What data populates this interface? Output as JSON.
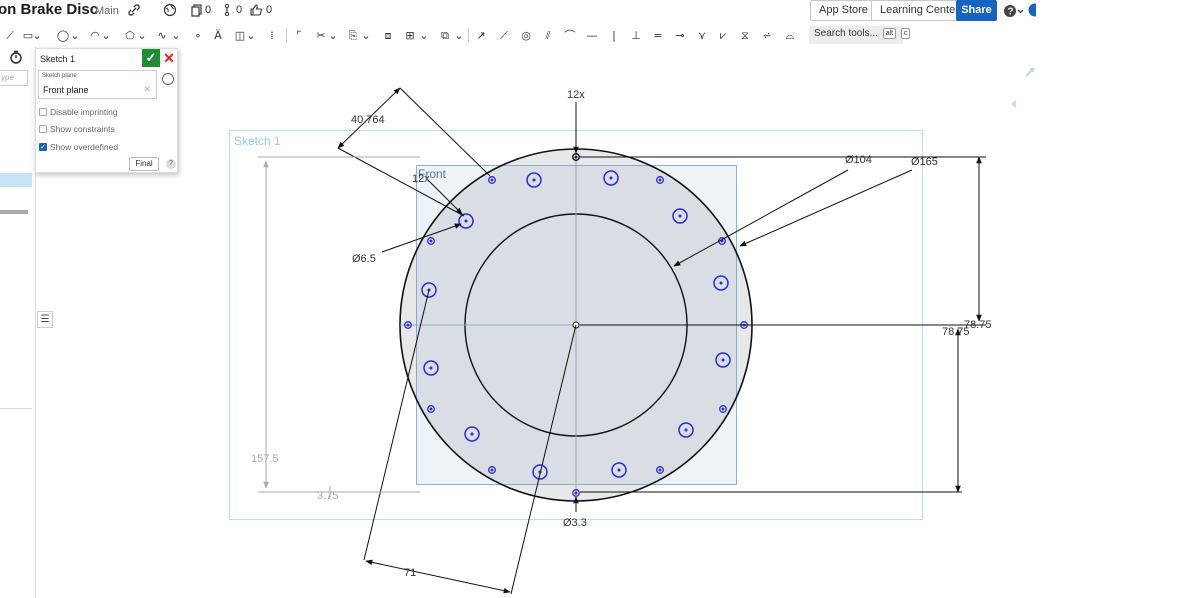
{
  "header": {
    "doc_title": "on Brake Disc",
    "branch": "Main",
    "count_a": "0",
    "count_b": "0",
    "count_c": "0",
    "app_store": "App Store",
    "learning_center": "Learning Center",
    "share": "Share",
    "help_icon": "help-icon",
    "accent": "#1565c0"
  },
  "toolbar": {
    "search_label": "Search tools...",
    "search_kbd1": "alt",
    "search_kbd2": "c"
  },
  "left_rail": {
    "filter_placeholder": "ype"
  },
  "sketch_dialog": {
    "title": "Sketch 1",
    "plane_label": "Sketch plane",
    "plane_value": "Front plane",
    "options": [
      {
        "label": "Disable imprinting",
        "checked": false
      },
      {
        "label": "Show constraints",
        "checked": false
      },
      {
        "label": "Show overdefined",
        "checked": true
      }
    ],
    "final_label": "Final"
  },
  "viewport": {
    "sketch_label": "Sketch 1",
    "plane_label": "Front",
    "dimensions": {
      "dim_40764": "40.764",
      "dim_12x_top": "12x",
      "dim_12x_inner": "12x",
      "dim_d104": "Ø104",
      "dim_d165": "Ø165",
      "dim_d65": "Ø6.5",
      "dim_7875_a": "78.75",
      "dim_7875_b": "78.75",
      "dim_1575": "157.5",
      "dim_375": "3.75",
      "dim_d33": "Ø3.3",
      "dim_71": "71"
    }
  }
}
